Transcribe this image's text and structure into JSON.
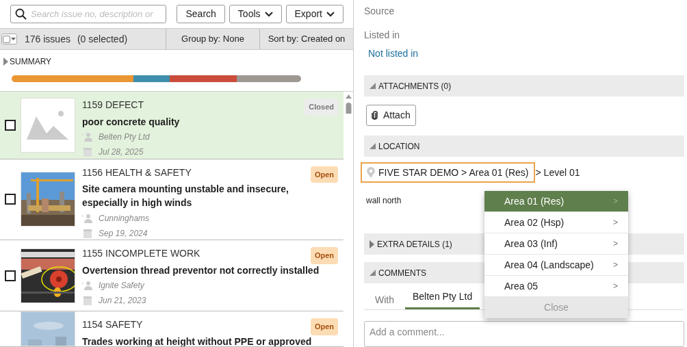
{
  "toolbar": {
    "search": {
      "placeholder": "Search issue no, description or"
    },
    "buttons": [
      {
        "label": "Search",
        "dropdown": false
      },
      {
        "label": "Tools",
        "dropdown": true
      },
      {
        "label": "Export",
        "dropdown": true
      }
    ]
  },
  "list_header": {
    "select_all": {
      "checked": false
    },
    "count": "176 issues",
    "selected_count": "(0 selected)",
    "group_by": "Group by: None",
    "sort_by": "Sort by: Created on"
  },
  "summary": {
    "title": "SUMMARY",
    "expanded": false
  },
  "issues": [
    {
      "heading": "1159 DEFECT",
      "title": "poor concrete quality",
      "company": "Belten Pty Ltd",
      "date": "Jul 28, 2025",
      "status": {
        "label": "Closed",
        "kind": "closed"
      },
      "selected": true,
      "checked": false,
      "kind": "placeholder"
    },
    {
      "heading": "1156 HEALTH & SAFETY",
      "title": "Site camera mounting unstable and insecure, especially in high winds",
      "company": "Cunninghams",
      "date": "Sep 19, 2024",
      "status": {
        "label": "Open",
        "kind": "open"
      },
      "selected": false,
      "checked": false,
      "kind": "picture"
    },
    {
      "heading": "1155 INCOMPLETE WORK",
      "title": "Overtension thread preventor not correctly installed",
      "company": "Ignite Safety",
      "date": "Jun 21, 2023",
      "status": {
        "label": "Open",
        "kind": "open"
      },
      "selected": false,
      "checked": false,
      "kind": "picture"
    },
    {
      "heading": "1154 SAFETY",
      "title": "Trades working at height without PPE or approved",
      "status": {
        "label": "Open",
        "kind": "open"
      },
      "selected": false,
      "kind": "picture"
    }
  ],
  "details": {
    "source_label": "Source",
    "listed_label": "Listed in",
    "listed_value": "Not listed in"
  },
  "sections": [
    {
      "kind": "attachments",
      "title": "ATTACHMENTS (0)",
      "expanded": true,
      "button": "Attach"
    },
    {
      "kind": "location",
      "title": "LOCATION",
      "expanded": true,
      "path": "FIVE STAR DEMO > Area 01 (Res)",
      "path_rest": "> Level 01",
      "note": "wall north"
    },
    {
      "kind": "extra",
      "title": "EXTRA DETAILS (1)",
      "expanded": false
    },
    {
      "kind": "comments",
      "title": "COMMENTS",
      "expanded": true,
      "with_label": "With",
      "tabs": [
        {
          "label": "Belten Pty Ltd",
          "selected": true
        }
      ],
      "placeholder": "Add a comment..."
    }
  ],
  "location_menu": {
    "items": [
      {
        "label": "Area 01 (Res)",
        "arrow": ">",
        "selected": true
      },
      {
        "label": "Area 02 (Hsp)",
        "arrow": ">",
        "selected": false
      },
      {
        "label": "Area 03 (Inf)",
        "arrow": ">",
        "selected": false
      },
      {
        "label": "Area 04 (Landscape)",
        "arrow": ">",
        "selected": false
      },
      {
        "label": "Area 05",
        "arrow": ">",
        "selected": false
      }
    ],
    "close": "Close"
  }
}
